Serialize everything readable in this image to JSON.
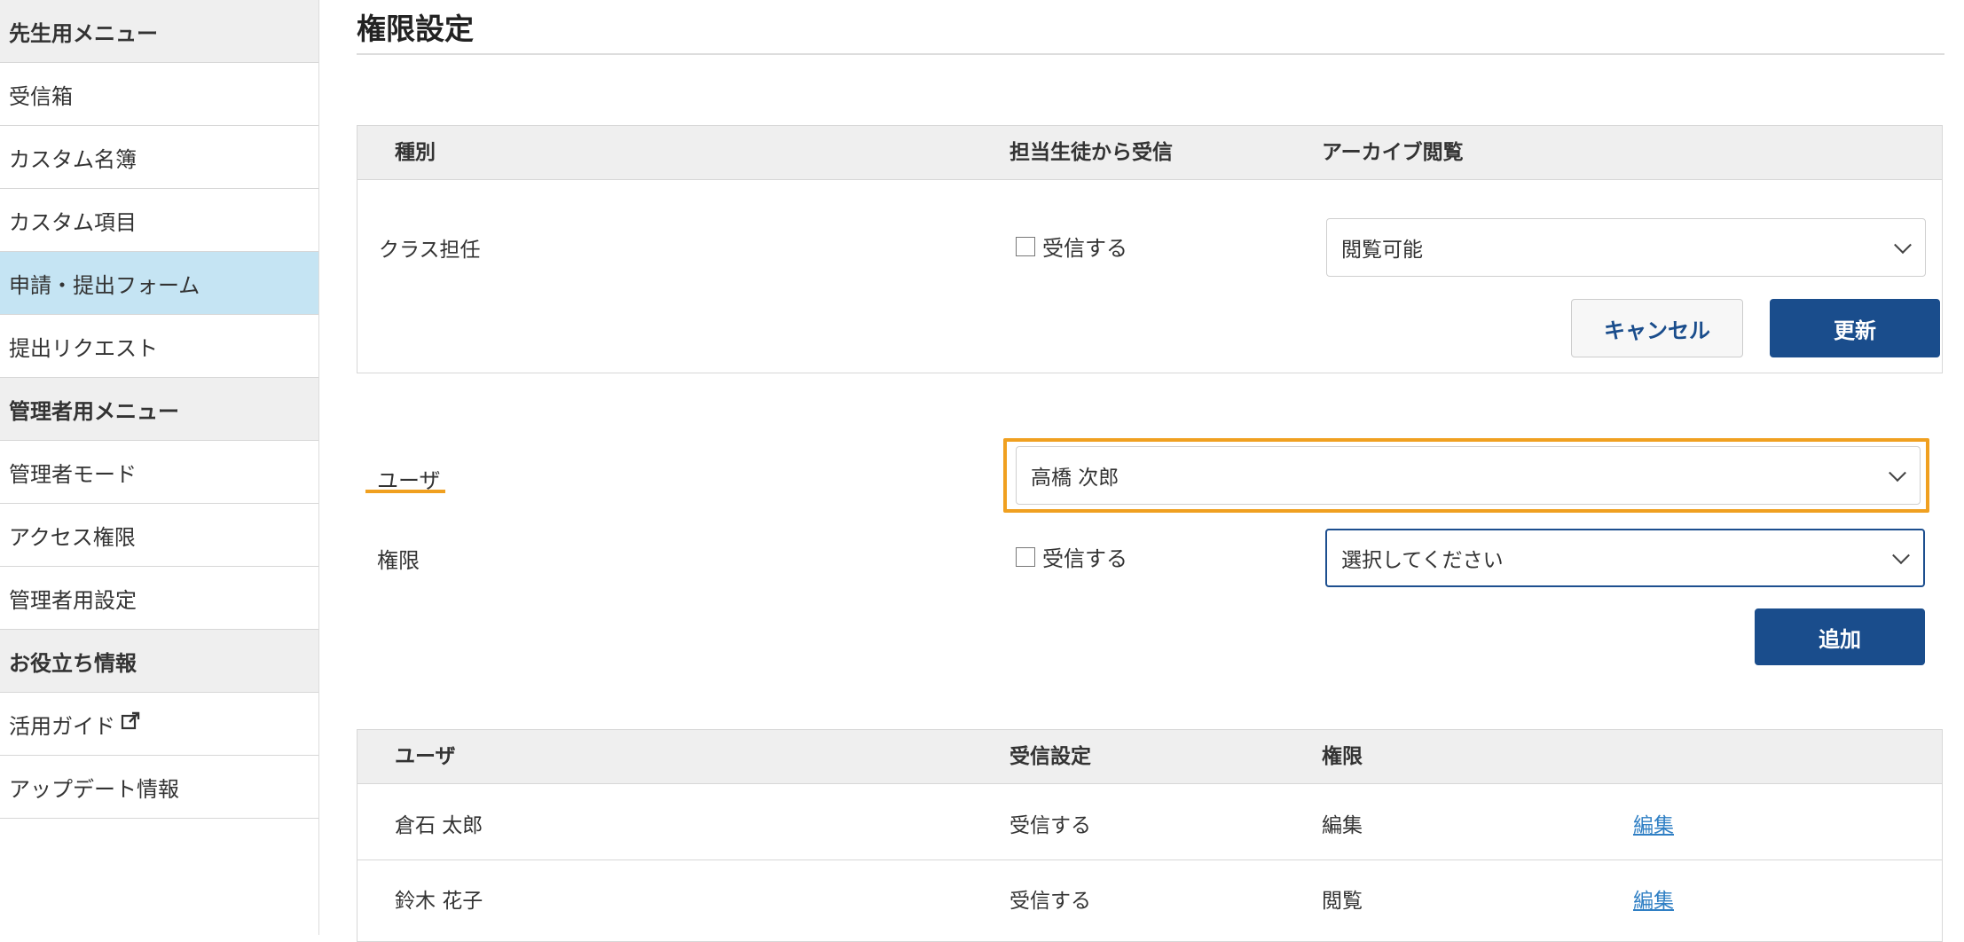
{
  "sidebar": {
    "items": [
      {
        "label": "先生用メニュー",
        "type": "header"
      },
      {
        "label": "受信箱",
        "type": "item"
      },
      {
        "label": "カスタム名簿",
        "type": "item"
      },
      {
        "label": "カスタム項目",
        "type": "item"
      },
      {
        "label": "申請・提出フォーム",
        "type": "item",
        "active": true
      },
      {
        "label": "提出リクエスト",
        "type": "item"
      },
      {
        "label": "管理者用メニュー",
        "type": "header"
      },
      {
        "label": "管理者モード",
        "type": "item"
      },
      {
        "label": "アクセス権限",
        "type": "item"
      },
      {
        "label": "管理者用設定",
        "type": "item"
      },
      {
        "label": "お役立ち情報",
        "type": "header"
      },
      {
        "label": "活用ガイド",
        "type": "item",
        "icon": "external-link-icon"
      },
      {
        "label": "アップデート情報",
        "type": "item"
      }
    ]
  },
  "page": {
    "title": "権限設定"
  },
  "type_table": {
    "headers": [
      "種別",
      "担当生徒から受信",
      "アーカイブ閲覧"
    ],
    "row": {
      "type": "クラス担任",
      "receive_label": "受信する",
      "receive_checked": false,
      "archive_value": "閲覧可能"
    },
    "cancel_label": "キャンセル",
    "update_label": "更新"
  },
  "add_form": {
    "user_label": "ユーザ",
    "user_value": "高橋 次郎",
    "permission_label": "権限",
    "receive_label": "受信する",
    "receive_checked": false,
    "permission_placeholder": "選択してください",
    "add_label": "追加"
  },
  "user_table": {
    "headers": [
      "ユーザ",
      "受信設定",
      "権限"
    ],
    "rows": [
      {
        "user": "倉石 太郎",
        "receive": "受信する",
        "permission": "編集",
        "action": "編集"
      },
      {
        "user": "鈴木 花子",
        "receive": "受信する",
        "permission": "閲覧",
        "action": "編集"
      }
    ]
  },
  "colors": {
    "primary": "#1a4d8c",
    "highlight": "#f0a020",
    "active_nav": "#c5e4f3",
    "link": "#2f7fc4"
  }
}
